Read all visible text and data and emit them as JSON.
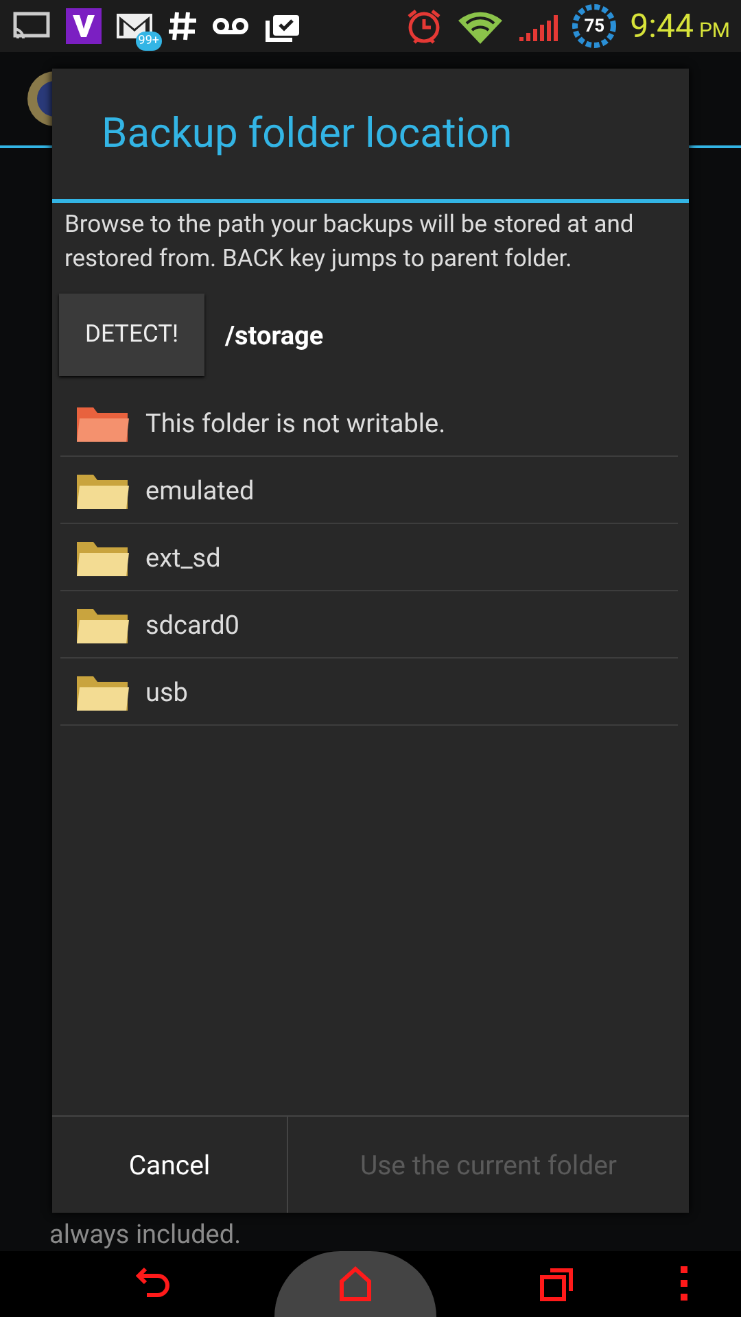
{
  "status_bar": {
    "mail_badge": "99+",
    "battery": "75",
    "time": "9:44",
    "ampm": "PM"
  },
  "background": {
    "footer_text": "always included."
  },
  "dialog": {
    "title": "Backup folder location",
    "description": "Browse to the path your backups will be stored at and restored from. BACK key jumps to parent folder.",
    "detect_button": "DETECT!",
    "path": "/storage",
    "folders": [
      {
        "name": "This folder is not writable.",
        "kind": "unwritable"
      },
      {
        "name": "emulated",
        "kind": "folder"
      },
      {
        "name": "ext_sd",
        "kind": "folder"
      },
      {
        "name": "sdcard0",
        "kind": "folder"
      },
      {
        "name": "usb",
        "kind": "folder"
      }
    ],
    "buttons": [
      {
        "label": "Cancel",
        "disabled": false
      },
      {
        "label": "Use the current folder",
        "disabled": true
      }
    ]
  }
}
